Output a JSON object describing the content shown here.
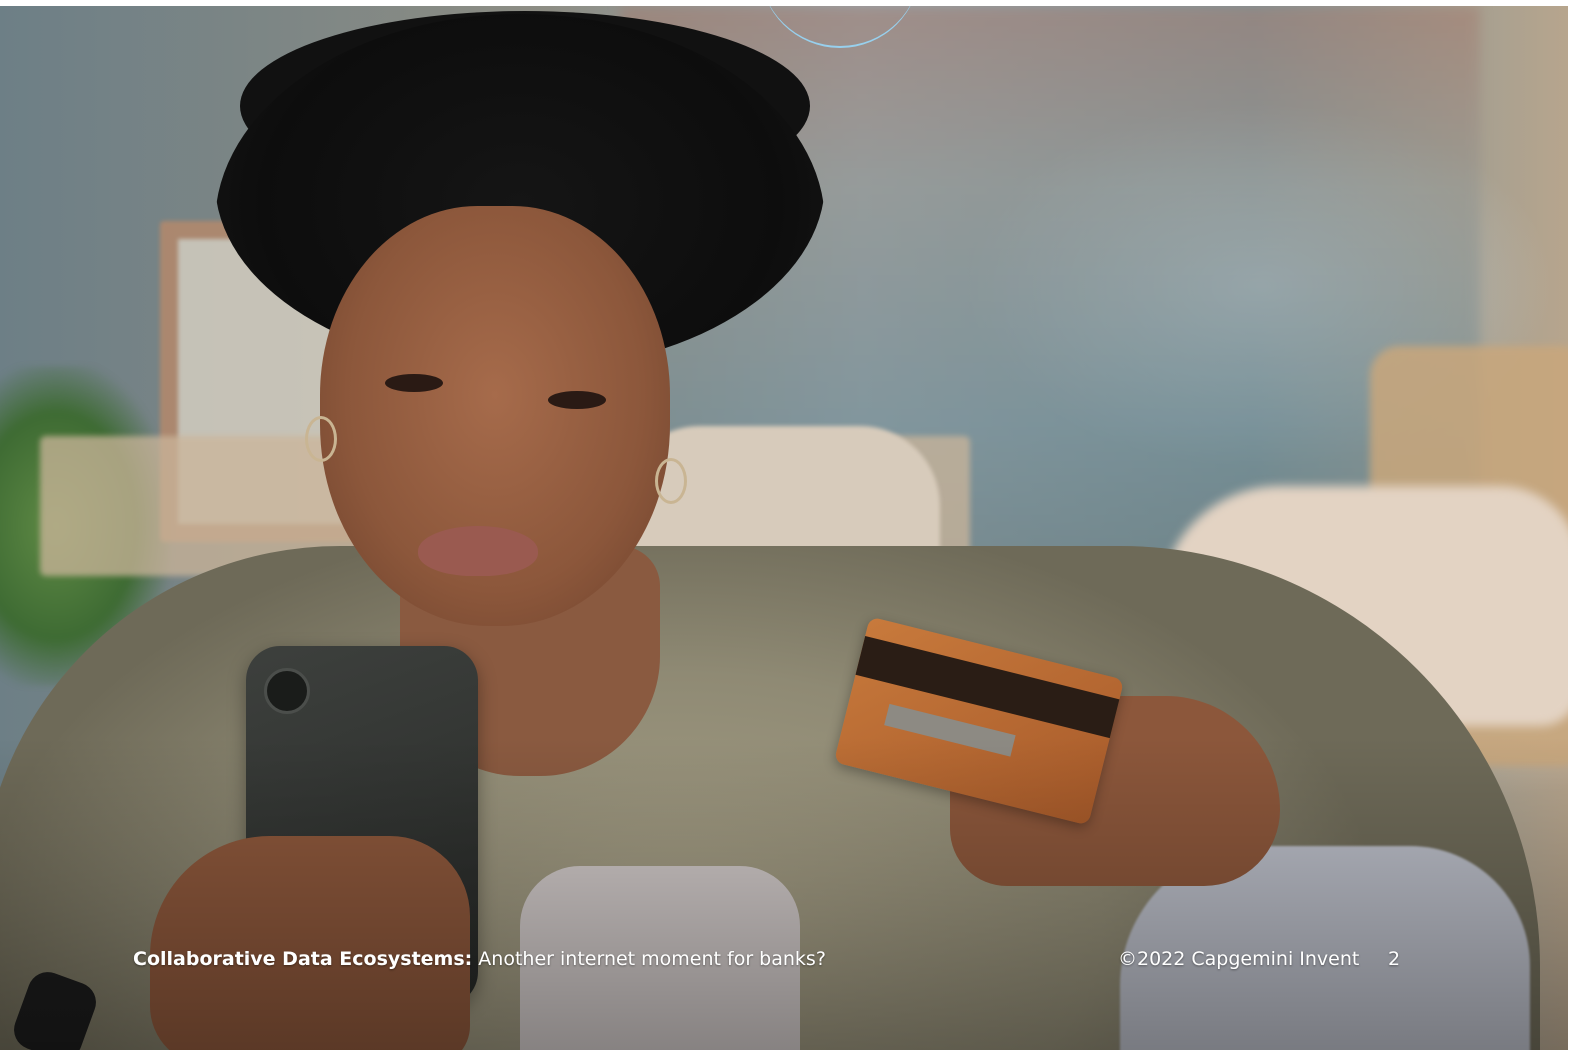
{
  "slide": {
    "photo": "Woman with curly hair looking at smartphone while holding a credit card",
    "footer": {
      "title_bold": "Collaborative Data Ecosystems:",
      "title_rest": " Another internet moment for banks?",
      "copyright": "©2022 Capgemini Invent",
      "page_number": "2"
    }
  }
}
